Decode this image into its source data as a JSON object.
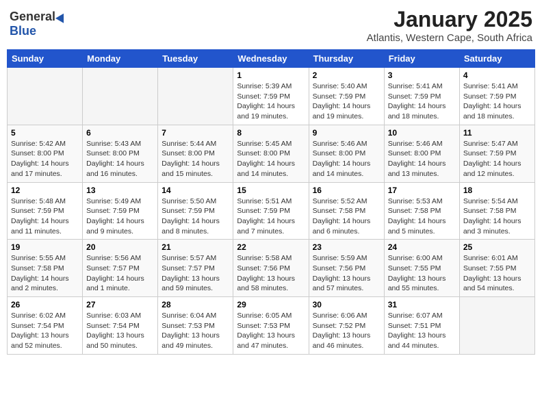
{
  "header": {
    "logo_general": "General",
    "logo_blue": "Blue",
    "title": "January 2025",
    "subtitle": "Atlantis, Western Cape, South Africa"
  },
  "days_of_week": [
    "Sunday",
    "Monday",
    "Tuesday",
    "Wednesday",
    "Thursday",
    "Friday",
    "Saturday"
  ],
  "weeks": [
    [
      {
        "day": "",
        "info": ""
      },
      {
        "day": "",
        "info": ""
      },
      {
        "day": "",
        "info": ""
      },
      {
        "day": "1",
        "info": "Sunrise: 5:39 AM\nSunset: 7:59 PM\nDaylight: 14 hours\nand 19 minutes."
      },
      {
        "day": "2",
        "info": "Sunrise: 5:40 AM\nSunset: 7:59 PM\nDaylight: 14 hours\nand 19 minutes."
      },
      {
        "day": "3",
        "info": "Sunrise: 5:41 AM\nSunset: 7:59 PM\nDaylight: 14 hours\nand 18 minutes."
      },
      {
        "day": "4",
        "info": "Sunrise: 5:41 AM\nSunset: 7:59 PM\nDaylight: 14 hours\nand 18 minutes."
      }
    ],
    [
      {
        "day": "5",
        "info": "Sunrise: 5:42 AM\nSunset: 8:00 PM\nDaylight: 14 hours\nand 17 minutes."
      },
      {
        "day": "6",
        "info": "Sunrise: 5:43 AM\nSunset: 8:00 PM\nDaylight: 14 hours\nand 16 minutes."
      },
      {
        "day": "7",
        "info": "Sunrise: 5:44 AM\nSunset: 8:00 PM\nDaylight: 14 hours\nand 15 minutes."
      },
      {
        "day": "8",
        "info": "Sunrise: 5:45 AM\nSunset: 8:00 PM\nDaylight: 14 hours\nand 14 minutes."
      },
      {
        "day": "9",
        "info": "Sunrise: 5:46 AM\nSunset: 8:00 PM\nDaylight: 14 hours\nand 14 minutes."
      },
      {
        "day": "10",
        "info": "Sunrise: 5:46 AM\nSunset: 8:00 PM\nDaylight: 14 hours\nand 13 minutes."
      },
      {
        "day": "11",
        "info": "Sunrise: 5:47 AM\nSunset: 7:59 PM\nDaylight: 14 hours\nand 12 minutes."
      }
    ],
    [
      {
        "day": "12",
        "info": "Sunrise: 5:48 AM\nSunset: 7:59 PM\nDaylight: 14 hours\nand 11 minutes."
      },
      {
        "day": "13",
        "info": "Sunrise: 5:49 AM\nSunset: 7:59 PM\nDaylight: 14 hours\nand 9 minutes."
      },
      {
        "day": "14",
        "info": "Sunrise: 5:50 AM\nSunset: 7:59 PM\nDaylight: 14 hours\nand 8 minutes."
      },
      {
        "day": "15",
        "info": "Sunrise: 5:51 AM\nSunset: 7:59 PM\nDaylight: 14 hours\nand 7 minutes."
      },
      {
        "day": "16",
        "info": "Sunrise: 5:52 AM\nSunset: 7:58 PM\nDaylight: 14 hours\nand 6 minutes."
      },
      {
        "day": "17",
        "info": "Sunrise: 5:53 AM\nSunset: 7:58 PM\nDaylight: 14 hours\nand 5 minutes."
      },
      {
        "day": "18",
        "info": "Sunrise: 5:54 AM\nSunset: 7:58 PM\nDaylight: 14 hours\nand 3 minutes."
      }
    ],
    [
      {
        "day": "19",
        "info": "Sunrise: 5:55 AM\nSunset: 7:58 PM\nDaylight: 14 hours\nand 2 minutes."
      },
      {
        "day": "20",
        "info": "Sunrise: 5:56 AM\nSunset: 7:57 PM\nDaylight: 14 hours\nand 1 minute."
      },
      {
        "day": "21",
        "info": "Sunrise: 5:57 AM\nSunset: 7:57 PM\nDaylight: 13 hours\nand 59 minutes."
      },
      {
        "day": "22",
        "info": "Sunrise: 5:58 AM\nSunset: 7:56 PM\nDaylight: 13 hours\nand 58 minutes."
      },
      {
        "day": "23",
        "info": "Sunrise: 5:59 AM\nSunset: 7:56 PM\nDaylight: 13 hours\nand 57 minutes."
      },
      {
        "day": "24",
        "info": "Sunrise: 6:00 AM\nSunset: 7:55 PM\nDaylight: 13 hours\nand 55 minutes."
      },
      {
        "day": "25",
        "info": "Sunrise: 6:01 AM\nSunset: 7:55 PM\nDaylight: 13 hours\nand 54 minutes."
      }
    ],
    [
      {
        "day": "26",
        "info": "Sunrise: 6:02 AM\nSunset: 7:54 PM\nDaylight: 13 hours\nand 52 minutes."
      },
      {
        "day": "27",
        "info": "Sunrise: 6:03 AM\nSunset: 7:54 PM\nDaylight: 13 hours\nand 50 minutes."
      },
      {
        "day": "28",
        "info": "Sunrise: 6:04 AM\nSunset: 7:53 PM\nDaylight: 13 hours\nand 49 minutes."
      },
      {
        "day": "29",
        "info": "Sunrise: 6:05 AM\nSunset: 7:53 PM\nDaylight: 13 hours\nand 47 minutes."
      },
      {
        "day": "30",
        "info": "Sunrise: 6:06 AM\nSunset: 7:52 PM\nDaylight: 13 hours\nand 46 minutes."
      },
      {
        "day": "31",
        "info": "Sunrise: 6:07 AM\nSunset: 7:51 PM\nDaylight: 13 hours\nand 44 minutes."
      },
      {
        "day": "",
        "info": ""
      }
    ]
  ]
}
